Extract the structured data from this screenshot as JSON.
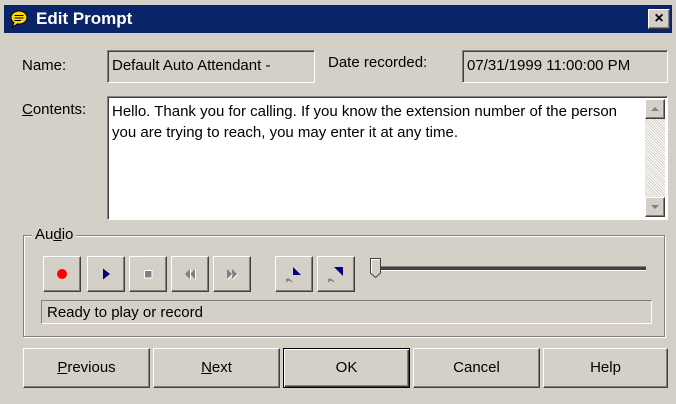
{
  "window": {
    "title": "Edit Prompt",
    "close_glyph": "×"
  },
  "fields": {
    "name_label_pre": "",
    "name_label_accel": "",
    "name_label_post": "Name:",
    "name_value": "Default Auto Attendant -",
    "date_label": "Date recorded:",
    "date_value": "07/31/1999 11:00:00 PM",
    "contents_label_accel": "C",
    "contents_label_post": "ontents:",
    "contents_value": "Hello. Thank you for calling. If you know the extension number of the person you are trying to reach, you may enter it at any time."
  },
  "audio": {
    "group_label_pre": "Au",
    "group_label_accel": "d",
    "group_label_post": "io",
    "status": "Ready to play or record",
    "slider_position": 0,
    "controls": [
      {
        "name": "record",
        "icon": "record-icon",
        "color": "#ff0000"
      },
      {
        "name": "play",
        "icon": "play-icon",
        "color": "#000080"
      },
      {
        "name": "stop",
        "icon": "stop-icon",
        "color": "#ffffff"
      },
      {
        "name": "rewind",
        "icon": "rewind-icon",
        "color": "#ffffff"
      },
      {
        "name": "fast-forward",
        "icon": "fast-forward-icon",
        "color": "#ffffff"
      },
      {
        "name": "mark-start",
        "icon": "mark-start-icon",
        "color": "#000080"
      },
      {
        "name": "mark-end",
        "icon": "mark-end-icon",
        "color": "#000080"
      }
    ]
  },
  "buttons": {
    "previous_accel": "P",
    "previous_post": "revious",
    "next_accel": "N",
    "next_post": "ext",
    "ok": "OK",
    "cancel": "Cancel",
    "help": "Help"
  }
}
